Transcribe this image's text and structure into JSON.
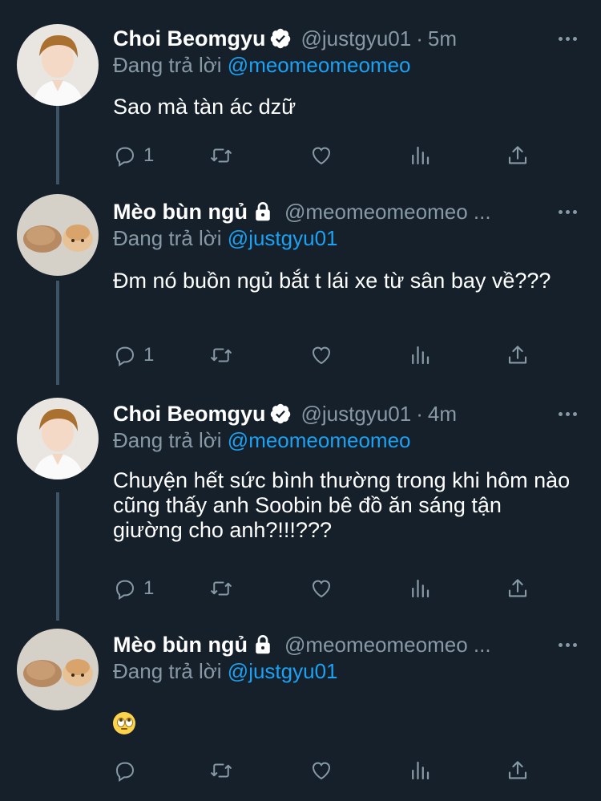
{
  "colors": {
    "background": "#15202b",
    "mention": "#1da1f2",
    "secondary": "#8899a6",
    "thread_line": "#3d5466"
  },
  "tweets": [
    {
      "name": "Choi Beomgyu",
      "verified": true,
      "handle": "@justgyu01",
      "dot": "·",
      "time": "5m",
      "replying_label": "Đang trả lời",
      "replying_to": "@meomeomeomeo",
      "text": "Sao mà tàn ác dzữ",
      "reply_count": "1",
      "avatar": "person-avatar"
    },
    {
      "name": "Mèo bùn ngủ",
      "locked": true,
      "handle": "@meomeomeomeo ...",
      "replying_label": "Đang trả lời",
      "replying_to": "@justgyu01",
      "text": "Đm nó buồn ngủ bắt t lái xe từ sân bay về???",
      "reply_count": "1",
      "avatar": "cat-bread-avatar"
    },
    {
      "name": "Choi Beomgyu",
      "verified": true,
      "handle": "@justgyu01",
      "dot": "·",
      "time": "4m",
      "replying_label": "Đang trả lời",
      "replying_to": "@meomeomeomeo",
      "text": "Chuyện hết sức bình thường trong khi hôm nào cũng thấy anh Soobin bê đồ ăn sáng tận giường cho anh?!!!???",
      "reply_count": "1",
      "avatar": "person-avatar"
    },
    {
      "name": "Mèo bùn ngủ",
      "locked": true,
      "handle": "@meomeomeomeo ...",
      "replying_label": "Đang trả lời",
      "replying_to": "@justgyu01",
      "text": "",
      "emoji": "face-with-rolling-eyes",
      "reply_count": "",
      "avatar": "cat-bread-avatar"
    }
  ]
}
